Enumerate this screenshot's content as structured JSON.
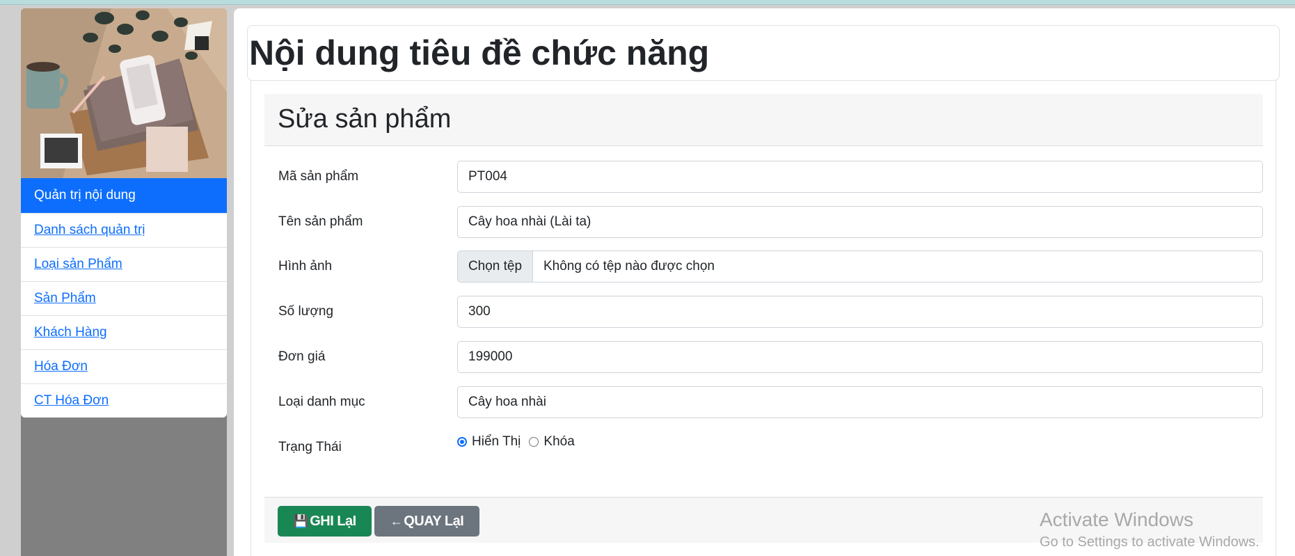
{
  "page": {
    "title": "Nội dung tiêu đề chức năng"
  },
  "sidebar": {
    "header": "Quản trị nội dung",
    "items": [
      {
        "label": "Danh sách quản trị"
      },
      {
        "label": "Loại sản Phẩm"
      },
      {
        "label": "Sản Phẩm"
      },
      {
        "label": "Khách Hàng"
      },
      {
        "label": "Hóa Đơn"
      },
      {
        "label": "CT Hóa Đơn"
      }
    ]
  },
  "form": {
    "heading": "Sửa sản phẩm",
    "fields": {
      "product_code": {
        "label": "Mã sản phẩm",
        "value": "PT004"
      },
      "product_name": {
        "label": "Tên sản phẩm",
        "value": "Cây hoa nhài (Lài ta)"
      },
      "image": {
        "label": "Hình ảnh",
        "button": "Chọn tệp",
        "status": "Không có tệp nào được chọn"
      },
      "quantity": {
        "label": "Số lượng",
        "value": "300"
      },
      "price": {
        "label": "Đơn giá",
        "value": "199000"
      },
      "category": {
        "label": "Loại danh mục",
        "value": "Cây hoa nhài"
      },
      "status": {
        "label": "Trạng Thái",
        "options": [
          {
            "label": "Hiển Thị",
            "checked": true
          },
          {
            "label": "Khóa",
            "checked": false
          }
        ]
      }
    },
    "buttons": {
      "save": "GHI LạI",
      "back": "QUAY LạI"
    }
  },
  "watermark": {
    "title": "Activate Windows",
    "subtitle": "Go to Settings to activate Windows."
  },
  "colors": {
    "primary": "#0d6efd",
    "success": "#198754",
    "secondary": "#6c757d",
    "sidebar_bg": "#808080"
  },
  "icons": {
    "save": "floppy-disk-icon",
    "back": "arrow-left-icon"
  }
}
